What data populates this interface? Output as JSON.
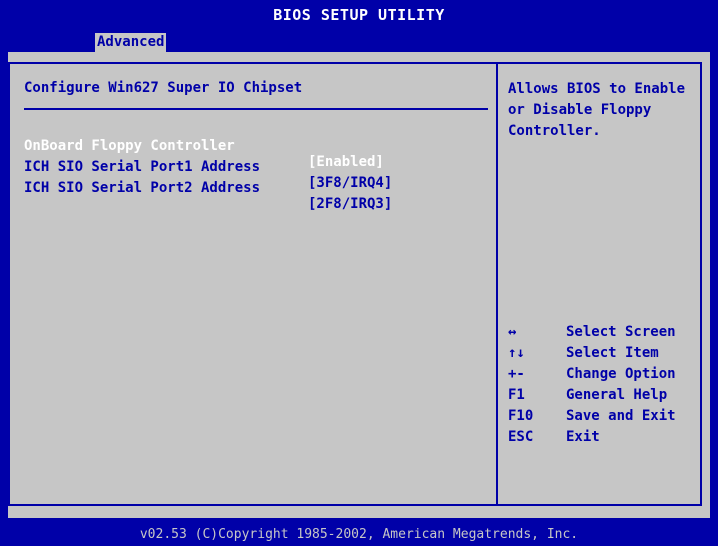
{
  "window": {
    "title": "BIOS SETUP UTILITY",
    "active_tab": "Advanced"
  },
  "main": {
    "section_title": "Configure Win627 Super IO Chipset",
    "settings": [
      {
        "label": "OnBoard Floppy Controller",
        "value": "[Enabled]",
        "selected": true
      },
      {
        "label": "ICH SIO Serial Port1 Address",
        "value": "[3F8/IRQ4]",
        "selected": false
      },
      {
        "label": "ICH SIO Serial Port2 Address",
        "value": "[2F8/IRQ3]",
        "selected": false
      }
    ]
  },
  "help": {
    "text": "Allows BIOS to Enable or Disable Floppy Controller."
  },
  "keys": [
    {
      "key": "↔",
      "desc": "Select Screen"
    },
    {
      "key": "↑↓",
      "desc": "Select Item"
    },
    {
      "key": "+-",
      "desc": "Change Option"
    },
    {
      "key": "F1",
      "desc": "General Help"
    },
    {
      "key": "F10",
      "desc": "Save and Exit"
    },
    {
      "key": "ESC",
      "desc": "Exit"
    }
  ],
  "footer": {
    "text": "v02.53 (C)Copyright 1985-2002, American Megatrends, Inc."
  },
  "colors": {
    "background": "#0000a8",
    "panel": "#c6c6c6",
    "text": "#0000a8",
    "highlight": "#ffffff"
  }
}
